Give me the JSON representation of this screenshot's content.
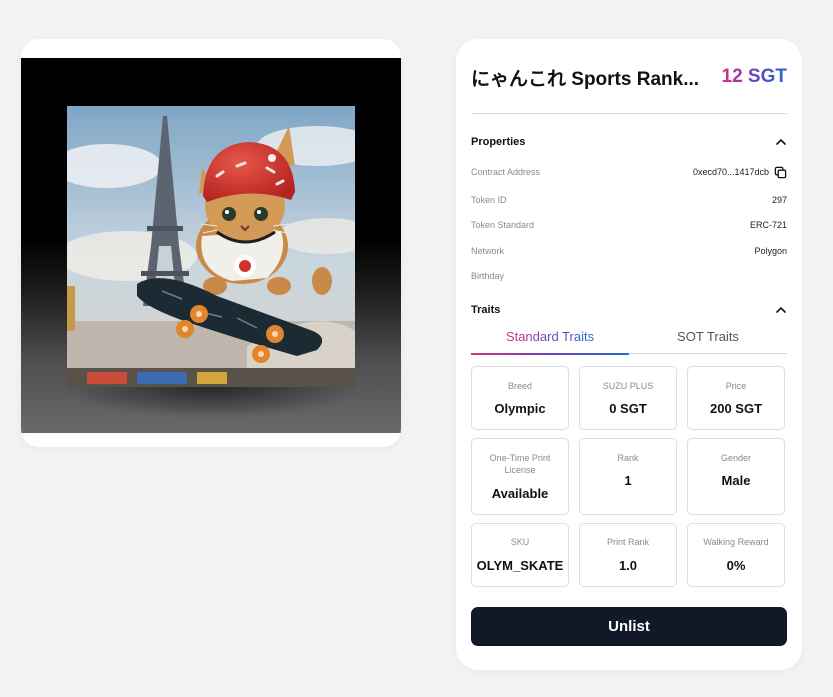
{
  "nft": {
    "title": "にゃんこれ Sports Rank...",
    "price": "12 SGT",
    "image_alt": "Cat in red helmet skateboarding in front of the Eiffel Tower"
  },
  "properties": {
    "heading": "Properties",
    "rows": [
      {
        "label": "Contract Address",
        "value": "0xecd70...1417dcb"
      },
      {
        "label": "Token ID",
        "value": "297"
      },
      {
        "label": "Token Standard",
        "value": "ERC-721"
      },
      {
        "label": "Network",
        "value": "Polygon"
      },
      {
        "label": "Birthday",
        "value": ""
      }
    ]
  },
  "traits": {
    "heading": "Traits",
    "tabs": [
      {
        "label": "Standard Traits",
        "active": true
      },
      {
        "label": "SOT Traits",
        "active": false
      }
    ],
    "cards": [
      {
        "label": "Breed",
        "value": "Olympic"
      },
      {
        "label": "SUZU PLUS",
        "value": "0 SGT"
      },
      {
        "label": "Price",
        "value": "200 SGT"
      },
      {
        "label": "One-Time Print License",
        "value": "Available"
      },
      {
        "label": "Rank",
        "value": "1"
      },
      {
        "label": "Gender",
        "value": "Male"
      },
      {
        "label": "SKU",
        "value": "OLYM_SKATE"
      },
      {
        "label": "Print Rank",
        "value": "1.0"
      },
      {
        "label": "Walking Reward",
        "value": "0%"
      }
    ]
  },
  "actions": {
    "unlist_label": "Unlist"
  },
  "icons": {
    "copy": "copy-icon",
    "chevron": "chevron-up-icon"
  },
  "colors": {
    "accent_gradient": [
      "#d8327f",
      "#6b3fc2",
      "#1e6fcf"
    ],
    "button_bg": "#111827",
    "page_bg": "#f3f3f4"
  }
}
